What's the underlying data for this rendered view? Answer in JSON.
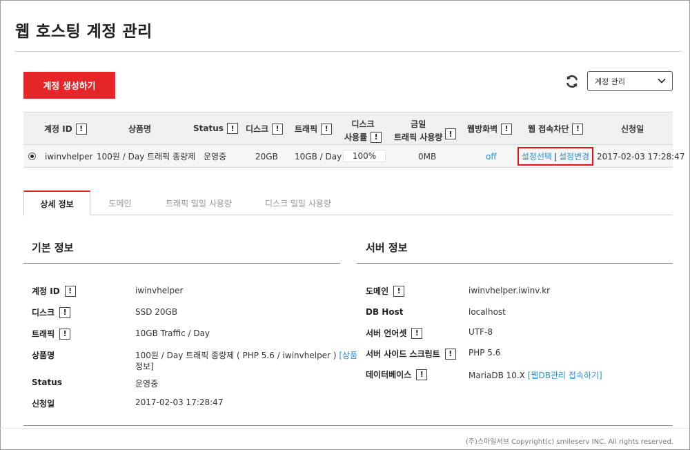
{
  "page": {
    "title": "웹 호스팅 계정 관리"
  },
  "toolbar": {
    "create_label": "계정 생성하기",
    "refresh_icon": "refresh-icon",
    "select_value": "계정 관리"
  },
  "table": {
    "headers": {
      "account_id": "계정 ID",
      "product": "상품명",
      "status": "Status",
      "disk": "디스크",
      "traffic": "트래픽",
      "disk_usage_1": "디스크",
      "disk_usage_2": "사용률",
      "today_traffic_1": "금일",
      "today_traffic_2": "트래픽 사용량",
      "firewall": "웹방화벽",
      "access_block": "웹 접속차단",
      "applied": "신청일"
    },
    "row": {
      "account_id": "iwinvhelper",
      "product": "100원 / Day 트래픽 종량제",
      "status": "운영중",
      "disk": "20GB",
      "traffic": "10GB / Day",
      "disk_usage": "100%",
      "disk_usage_value": 100,
      "today_traffic": "0MB",
      "firewall": "off",
      "access_select": "설정선택",
      "access_separator": "|",
      "access_change": "설정변경",
      "applied": "2017-02-03 17:28:47"
    }
  },
  "info_glyph": "!",
  "tabs": [
    "상세 정보",
    "도메인",
    "트래픽 일일 사용량",
    "디스크 일일 사용량"
  ],
  "basic": {
    "title": "기본 정보",
    "labels": {
      "account_id": "계정 ID",
      "disk": "디스크",
      "traffic": "트래픽",
      "product": "상품명",
      "status": "Status",
      "applied": "신청일"
    },
    "values": {
      "account_id": "iwinvhelper",
      "disk": "SSD 20GB",
      "traffic": "10GB Traffic / Day",
      "product_line1": "100원 / Day 트래픽 종량제 ( PHP 5.6 / iwinvhelper )",
      "product_link1": "[상품",
      "product_link2": "정보]",
      "status": "운영중",
      "applied": "2017-02-03 17:28:47"
    }
  },
  "server": {
    "title": "서버 정보",
    "labels": {
      "domain": "도메인",
      "db_host": "DB Host",
      "charset": "서버 언어셋",
      "script": "서버 사이드 스크립트",
      "database": "데이터베이스"
    },
    "values": {
      "domain": "iwinvhelper.iwinv.kr",
      "db_host": "localhost",
      "charset": "UTF-8",
      "script": "PHP 5.6",
      "database": "MariaDB 10.X",
      "database_link": "[웹DB관리 접속하기]"
    }
  },
  "footer": {
    "copyright": "(주)스마일서브 Copyright(c) smileserv INC. All rights reserved."
  },
  "colors": {
    "accent": "#e52528",
    "link": "#2a8fd6"
  }
}
